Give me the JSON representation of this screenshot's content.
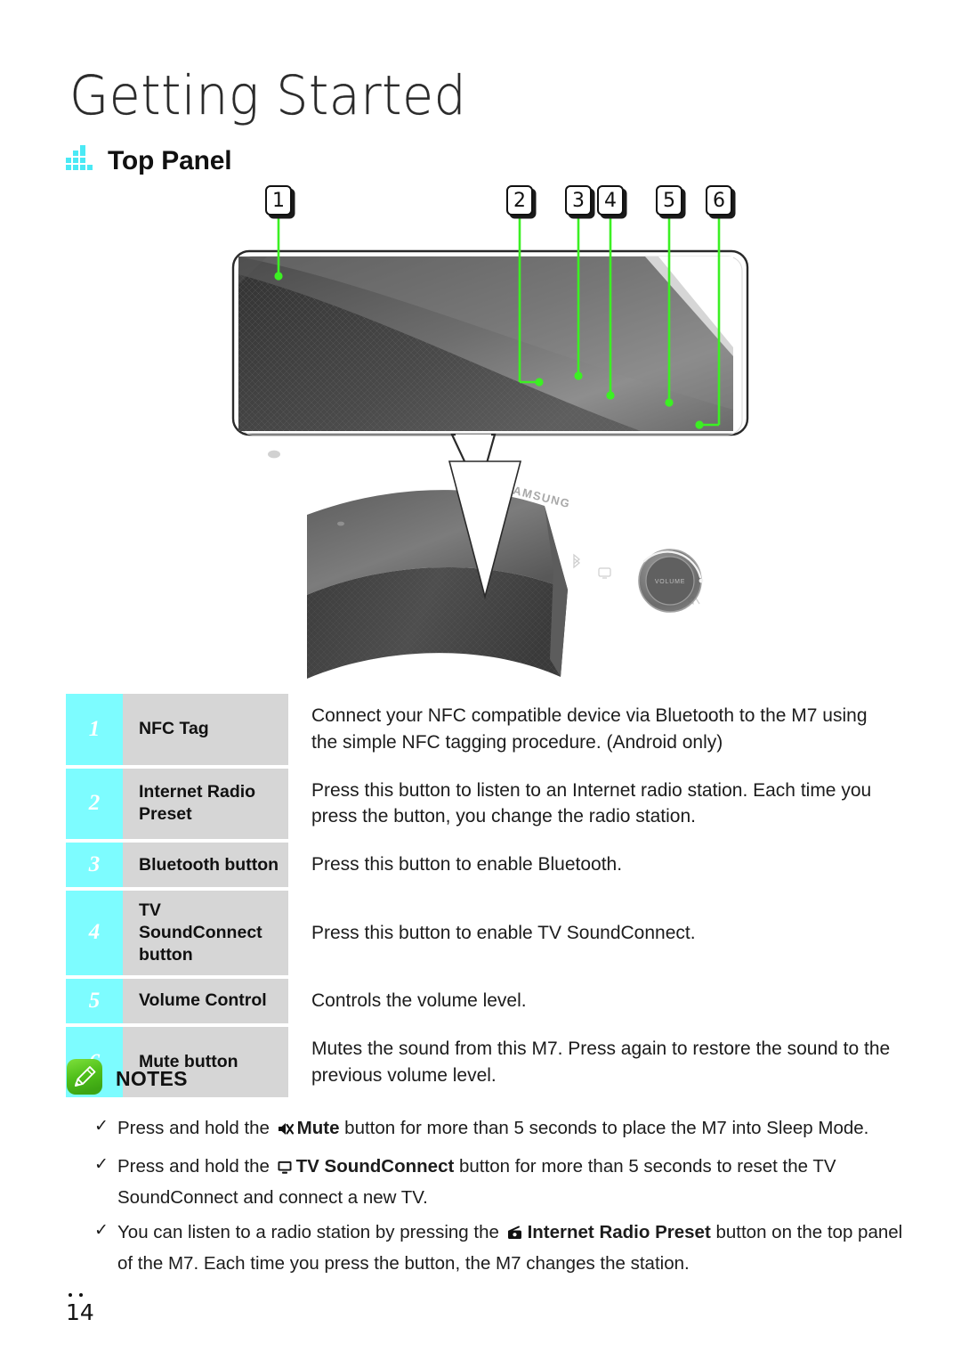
{
  "header": {
    "chapter_title": "Getting Started",
    "section_title": "Top Panel",
    "section_icon": "steps-bars-icon"
  },
  "illustration": {
    "callouts": [
      {
        "number": "1",
        "target": "nfc-tag"
      },
      {
        "number": "2",
        "target": "internet-radio-preset"
      },
      {
        "number": "3",
        "target": "bluetooth-button"
      },
      {
        "number": "4",
        "target": "tv-soundconnect-button"
      },
      {
        "number": "5",
        "target": "volume-control"
      },
      {
        "number": "6",
        "target": "mute-button"
      }
    ],
    "device_brand": "SAMSUNG",
    "dial_label": "VOLUME"
  },
  "spec_table": {
    "rows": [
      {
        "number": "1",
        "label": "NFC Tag",
        "description": "Connect your NFC compatible device via Bluetooth to the M7 using the simple NFC tagging procedure. (Android only)"
      },
      {
        "number": "2",
        "label": "Internet Radio Preset",
        "description": "Press this button to listen to an Internet radio station. Each time you press the button, you change the radio station."
      },
      {
        "number": "3",
        "label": "Bluetooth button",
        "description": "Press this button to enable Bluetooth."
      },
      {
        "number": "4",
        "label": "TV SoundConnect button",
        "description": "Press this button to enable TV SoundConnect."
      },
      {
        "number": "5",
        "label": "Volume Control",
        "description": "Controls the volume level."
      },
      {
        "number": "6",
        "label": "Mute button",
        "description": "Mutes the sound from this M7. Press again to restore the sound to the previous volume level."
      }
    ]
  },
  "notes": {
    "icon": "pencil-note-icon",
    "title": "NOTES",
    "items": [
      {
        "bullet": "✓",
        "icon": "mute-icon",
        "pre": "Press and hold the ",
        "bold": "Mute",
        "post": " button for more than 5 seconds to place the M7 into Sleep Mode."
      },
      {
        "bullet": "✓",
        "icon": "tv-icon",
        "pre": "Press and hold the ",
        "bold": "TV SoundConnect",
        "post": " button for more than 5 seconds to reset the TV SoundConnect and connect a new TV."
      },
      {
        "bullet": "✓",
        "icon": "radio-icon",
        "pre": "You can listen to a radio station by pressing the ",
        "bold": "Internet Radio Preset",
        "post": " button on the top panel of the M7. Each time you press the button, the M7 changes the station."
      }
    ]
  },
  "footer": {
    "page_number": "14"
  },
  "colors": {
    "accent_cyan": "#7dfcff",
    "label_gray": "#d6d6d6",
    "lead_green": "#3cf023",
    "note_green": "#5fc52e"
  }
}
